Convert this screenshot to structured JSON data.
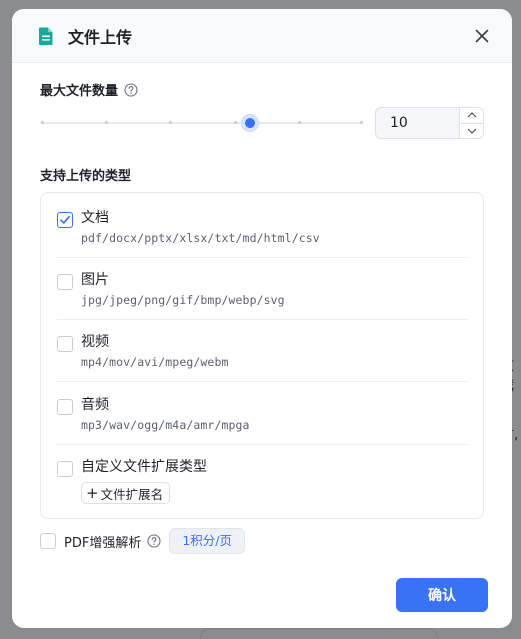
{
  "backdrop": {
    "fragments": [
      "文代",
      "件扌",
      "时,"
    ]
  },
  "dialog": {
    "title": "文件上传",
    "header_icon": "document-icon",
    "close_icon": "close-icon"
  },
  "max_files": {
    "label": "最大文件数量",
    "help_icon": "question-circle-icon",
    "value": "10",
    "slider_fraction": 0.65
  },
  "supported_types": {
    "label": "支持上传的类型",
    "items": [
      {
        "name": "文档",
        "extensions": "pdf/docx/pptx/xlsx/txt/md/html/csv",
        "checked": true
      },
      {
        "name": "图片",
        "extensions": "jpg/jpeg/png/gif/bmp/webp/svg",
        "checked": false
      },
      {
        "name": "视频",
        "extensions": "mp4/mov/avi/mpeg/webm",
        "checked": false
      },
      {
        "name": "音频",
        "extensions": "mp3/wav/ogg/m4a/amr/mpga",
        "checked": false
      },
      {
        "name": "自定义文件扩展类型",
        "checked": false,
        "add_button": "文件扩展名"
      }
    ]
  },
  "pdf_enhance": {
    "label": "PDF增强解析",
    "badge": "1积分/页",
    "checked": false
  },
  "footer": {
    "confirm_label": "确认"
  },
  "colors": {
    "accent": "#3873f6",
    "header_icon": "#19a89a",
    "overlay": "#8b8c8e"
  }
}
